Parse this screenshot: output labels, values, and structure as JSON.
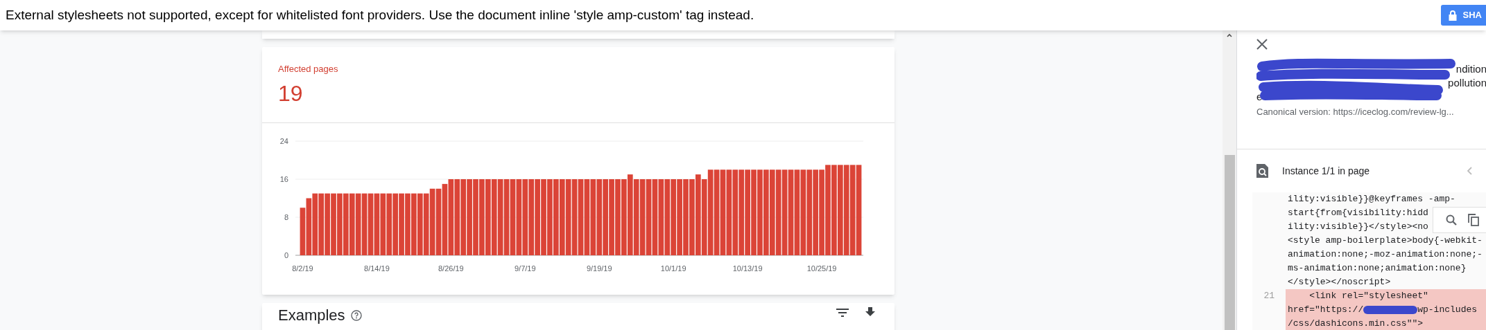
{
  "error_banner": {
    "message": "External stylesheets not supported, except for whitelisted font providers. Use the document inline 'style amp-custom' tag instead.",
    "share_button": "SHA"
  },
  "affected_card": {
    "label": "Affected pages",
    "count": "19",
    "chart_data": {
      "type": "bar",
      "categories": [
        "8/2/19",
        null,
        null,
        null,
        null,
        null,
        null,
        null,
        null,
        null,
        null,
        null,
        "8/14/19",
        null,
        null,
        null,
        null,
        null,
        null,
        null,
        null,
        null,
        null,
        null,
        "8/26/19",
        null,
        null,
        null,
        null,
        null,
        null,
        null,
        null,
        null,
        null,
        null,
        "9/7/19",
        null,
        null,
        null,
        null,
        null,
        null,
        null,
        null,
        null,
        null,
        null,
        "9/19/19",
        null,
        null,
        null,
        null,
        null,
        null,
        null,
        null,
        null,
        null,
        null,
        "10/1/19",
        null,
        null,
        null,
        null,
        null,
        null,
        null,
        null,
        null,
        null,
        null,
        "10/13/19",
        null,
        null,
        null,
        null,
        null,
        null,
        null,
        null,
        null,
        null,
        null,
        "10/25/19",
        null,
        null,
        null,
        null,
        null,
        null
      ],
      "series": [
        {
          "color": "#db4437",
          "values": [
            10,
            12,
            13,
            13,
            13,
            13,
            13,
            13,
            13,
            13,
            13,
            13,
            13,
            13,
            13,
            13,
            13,
            13,
            13,
            13,
            13,
            14,
            14,
            15,
            16,
            16,
            16,
            16,
            16,
            16,
            16,
            16,
            16,
            16,
            16,
            16,
            16,
            16,
            16,
            16,
            16,
            16,
            16,
            16,
            16,
            16,
            16,
            16,
            16,
            16,
            16,
            16,
            16,
            17,
            16,
            16,
            16,
            16,
            16,
            16,
            16,
            16,
            16,
            16,
            17,
            16,
            18,
            18,
            18,
            18,
            18,
            18,
            18,
            18,
            18,
            18,
            18,
            18,
            18,
            18,
            18,
            18,
            18,
            18,
            18,
            19,
            19,
            19,
            19,
            19,
            19
          ]
        }
      ],
      "ylim": [
        0,
        24
      ],
      "yticks": [
        0,
        8,
        16,
        24
      ]
    }
  },
  "examples_card": {
    "title": "Examples"
  },
  "detail_panel": {
    "description_fragments": [
      "ndition",
      "pollution",
      "e"
    ],
    "canonical": "Canonical version: https://iceclog.com/review-lg...",
    "instance_label": "Instance 1/1 in page",
    "code_lines": [
      {
        "text": "ility:visible}}@keyframes -amp-",
        "highlighted": false
      },
      {
        "text": "start{from{visibility:hidd",
        "highlighted": false
      },
      {
        "text": "ility:visible}}</style><no",
        "highlighted": false
      },
      {
        "text": "<style amp-boilerplate>body{-webkit-",
        "highlighted": false
      },
      {
        "text": "animation:none;-moz-animation:none;-",
        "highlighted": false
      },
      {
        "text": "ms-animation:none;animation:none}",
        "highlighted": false
      },
      {
        "text": "</style></noscript>",
        "highlighted": false
      },
      {
        "number": "21",
        "text": "    <link rel=\"stylesheet\"",
        "highlighted": true
      },
      {
        "text": "href=\"https://",
        "tail": "wp-includes",
        "highlighted": true
      },
      {
        "text": "/css/dashicons.min.css\"\">",
        "highlighted": true
      }
    ]
  }
}
